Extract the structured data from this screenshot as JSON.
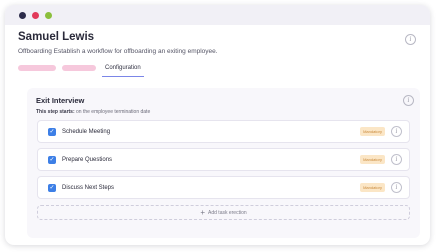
{
  "window": {
    "controls": [
      {
        "name": "close",
        "color": "#2c2b4a"
      },
      {
        "name": "minimize",
        "color": "#e23a5a"
      },
      {
        "name": "zoom",
        "color": "#8bbf3c"
      }
    ]
  },
  "header": {
    "title": "Samuel Lewis",
    "subtitle": "Offboarding Establish a workflow for offboarding an exiting employee.",
    "info_icon": "info-icon"
  },
  "tabs": {
    "active_label": "Configuration"
  },
  "panel": {
    "title": "Exit Interview",
    "step_prefix": "This step starts:",
    "step_text": " on the employee termination date",
    "tasks": [
      {
        "label": "Schedule Meeting",
        "badge": "Mandatory",
        "checked": true
      },
      {
        "label": "Prepare Questions",
        "badge": "Mandatory",
        "checked": true
      },
      {
        "label": "Discuss Next Steps",
        "badge": "Mandatory",
        "checked": true
      }
    ],
    "add_label": "Add task erection"
  },
  "colors": {
    "accent": "#3d7fe6",
    "badge_bg": "#fbe6c6",
    "badge_text": "#c98a3c",
    "tab_pill": "#f6c8dc",
    "tab_underline": "#7b86e8"
  }
}
